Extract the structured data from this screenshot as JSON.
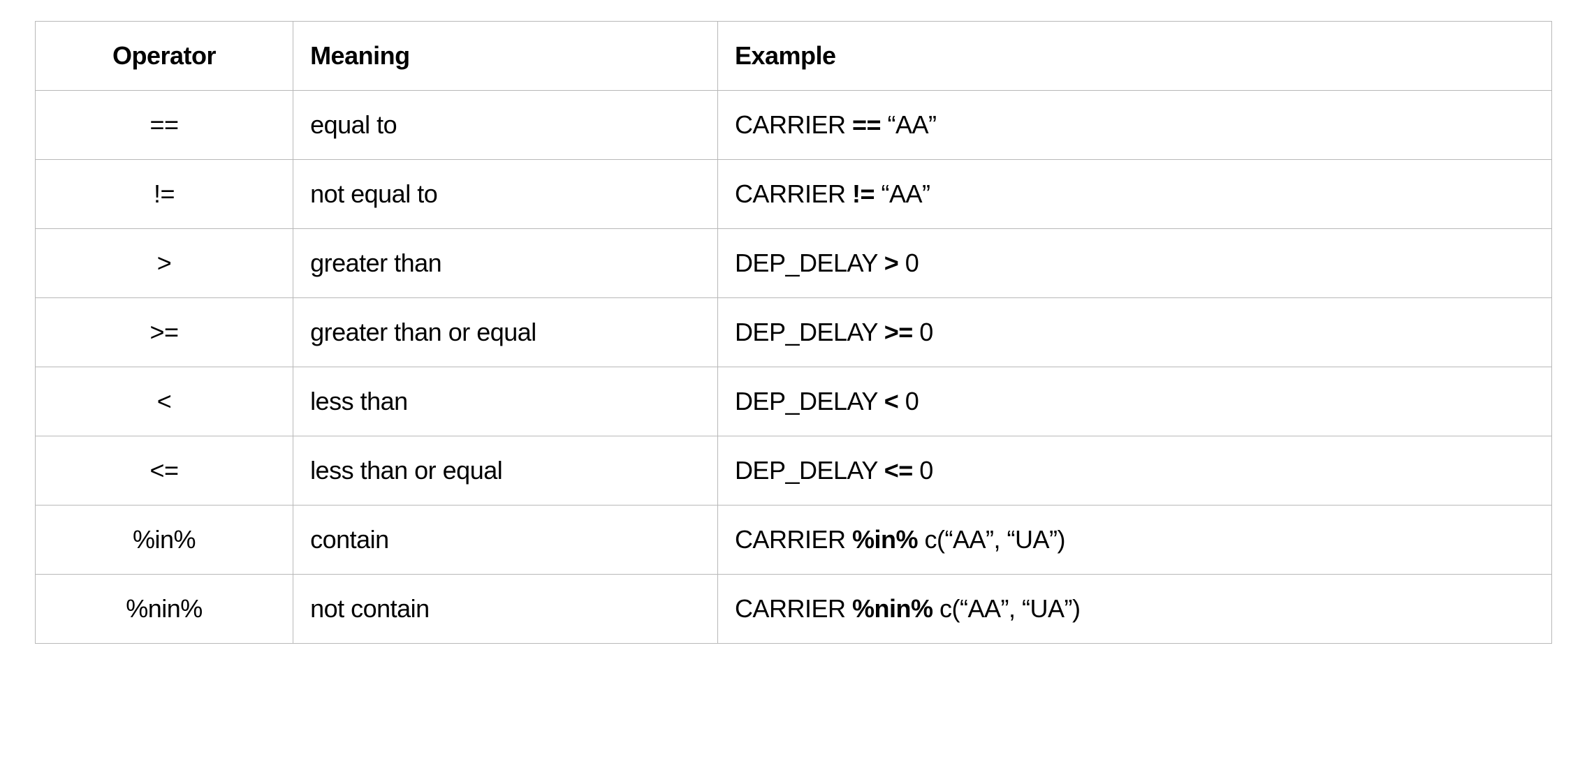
{
  "table": {
    "headers": {
      "operator": "Operator",
      "meaning": "Meaning",
      "example": "Example"
    },
    "rows": [
      {
        "operator": "==",
        "meaning": "equal to",
        "example_before": "CARRIER ",
        "example_op": "==",
        "example_after": " “AA”"
      },
      {
        "operator": "!=",
        "meaning": "not equal to",
        "example_before": "CARRIER ",
        "example_op": "!=",
        "example_after": " “AA”"
      },
      {
        "operator": ">",
        "meaning": "greater than",
        "example_before": "DEP_DELAY ",
        "example_op": ">",
        "example_after": " 0"
      },
      {
        "operator": ">=",
        "meaning": "greater than or equal",
        "example_before": "DEP_DELAY ",
        "example_op": ">=",
        "example_after": " 0"
      },
      {
        "operator": "<",
        "meaning": "less than",
        "example_before": "DEP_DELAY ",
        "example_op": "<",
        "example_after": " 0"
      },
      {
        "operator": "<=",
        "meaning": "less than or equal",
        "example_before": "DEP_DELAY ",
        "example_op": "<=",
        "example_after": " 0"
      },
      {
        "operator": "%in%",
        "meaning": "contain",
        "example_before": "CARRIER ",
        "example_op": "%in%",
        "example_after": " c(“AA”, “UA”)"
      },
      {
        "operator": "%nin%",
        "meaning": "not contain",
        "example_before": "CARRIER ",
        "example_op": "%nin%",
        "example_after": " c(“AA”, “UA”)"
      }
    ]
  }
}
